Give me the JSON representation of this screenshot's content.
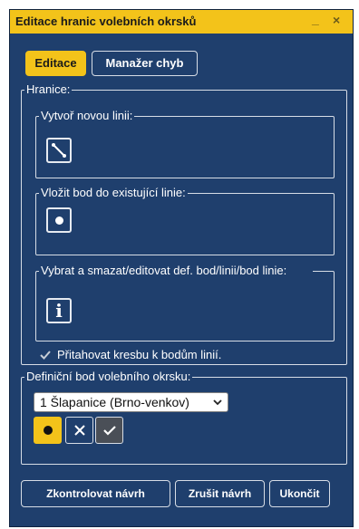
{
  "window": {
    "title": "Editace hranic volebních okrsků",
    "minimize_glyph": "_",
    "close_glyph": "×"
  },
  "tabs": [
    {
      "label": "Editace",
      "active": true
    },
    {
      "label": "Manažer chyb",
      "active": false
    }
  ],
  "boundaries": {
    "legend": "Hranice:",
    "create_line": {
      "legend": "Vytvoř novou linii:",
      "icon": "line-draw-icon"
    },
    "insert_point": {
      "legend": "Vložit bod do existující linie:",
      "icon": "point-icon"
    },
    "select_delete": {
      "legend": "Vybrat a smazat/editovat def. bod/linii/bod linie:",
      "icon": "info-icon",
      "glyph": "i"
    },
    "snap": {
      "label": "Přitahovat kresbu k bodům linií.",
      "checked": true
    }
  },
  "definition_point": {
    "legend": "Definiční bod volebního okrsku:",
    "select_value": "1 Šlapanice (Brno-venkov)",
    "buttons": [
      {
        "name": "definition-point-button",
        "icon": "dot-icon",
        "active": true
      },
      {
        "name": "cancel-point-button",
        "icon": "close-icon",
        "active": false
      },
      {
        "name": "confirm-point-button",
        "icon": "check-icon",
        "active": false
      }
    ]
  },
  "actions": {
    "check": "Zkontrolovat návrh",
    "cancel": "Zrušit návrh",
    "finish": "Ukončit"
  },
  "colors": {
    "panel_bg": "#1f3f6d",
    "accent": "#f3c31a",
    "text": "#ffffff"
  }
}
